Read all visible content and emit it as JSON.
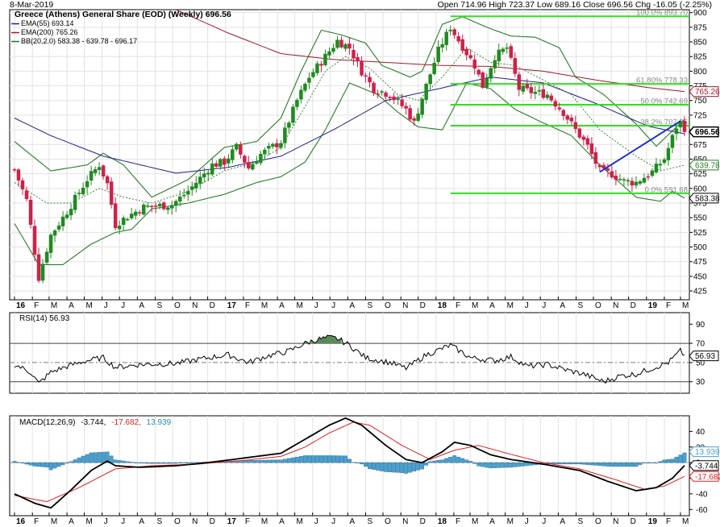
{
  "header": {
    "date": "8-Mar-2019",
    "title": "Greece (Athens) General Share (EOD) (Weekly) 696.56",
    "ohlc": "Open 714.96  High 723.37  Low 689.16  Close 696.56  Chg -16.05 (-2.25%)"
  },
  "legend": {
    "ema55": "EMA(55) 693.14",
    "ema200": "EMA(200) 765.26",
    "bb": "BB(20,2.0) 583.38 - 639.78 - 696.17",
    "rsi": "RSI(14) 56.93",
    "macd_name": "MACD(12,26,9)",
    "macd_v1": "-3.744,",
    "macd_v2": "-17.682,",
    "macd_v3": "13.939"
  },
  "colors": {
    "up": "#208a20",
    "down": "#d0204a",
    "ema55": "#20208a",
    "ema200": "#a01830",
    "bb": "#2a7a2a",
    "fib": "#33dd22",
    "trend": "#1a2ad0",
    "macd": "#000000",
    "signal": "#dd2222",
    "hist": "#4aa0d0",
    "rsiFill": "#5a8a5a"
  },
  "x_axis": {
    "labels": [
      "16",
      "F",
      "M",
      "A",
      "M",
      "J",
      "J",
      "A",
      "S",
      "O",
      "N",
      "D",
      "17",
      "F",
      "M",
      "A",
      "M",
      "J",
      "J",
      "A",
      "S",
      "O",
      "N",
      "D",
      "18",
      "F",
      "M",
      "A",
      "M",
      "J",
      "J",
      "A",
      "S",
      "O",
      "N",
      "D",
      "19",
      "F",
      "M"
    ],
    "bold": [
      "16",
      "17",
      "18",
      "19"
    ]
  },
  "chart_data": [
    {
      "type": "candlestick",
      "title": "Greece (Athens) General Share (EOD) (Weekly) 696.56",
      "x_start": "2016-01-01",
      "x_end": "2019-03-08",
      "ylim": [
        410,
        905
      ],
      "yticks": [
        425,
        450,
        475,
        500,
        525,
        550,
        575,
        600,
        625,
        650,
        675,
        700,
        725,
        750,
        775,
        800,
        825,
        850,
        875,
        900
      ],
      "price_anchors": [
        [
          "2016-01-01",
          632
        ],
        [
          "2016-01-22",
          580
        ],
        [
          "2016-02-12",
          448
        ],
        [
          "2016-03-04",
          520
        ],
        [
          "2016-04-01",
          560
        ],
        [
          "2016-05-06",
          615
        ],
        [
          "2016-05-27",
          640
        ],
        [
          "2016-06-10",
          608
        ],
        [
          "2016-06-24",
          538
        ],
        [
          "2016-07-15",
          552
        ],
        [
          "2016-08-12",
          568
        ],
        [
          "2016-09-30",
          572
        ],
        [
          "2016-10-28",
          595
        ],
        [
          "2016-12-09",
          640
        ],
        [
          "2016-12-30",
          645
        ],
        [
          "2017-01-20",
          670
        ],
        [
          "2017-02-10",
          635
        ],
        [
          "2017-03-03",
          658
        ],
        [
          "2017-04-07",
          680
        ],
        [
          "2017-05-05",
          750
        ],
        [
          "2017-05-26",
          790
        ],
        [
          "2017-06-23",
          825
        ],
        [
          "2017-07-14",
          852
        ],
        [
          "2017-08-04",
          840
        ],
        [
          "2017-08-25",
          800
        ],
        [
          "2017-09-15",
          770
        ],
        [
          "2017-10-13",
          760
        ],
        [
          "2017-11-10",
          735
        ],
        [
          "2017-11-24",
          712
        ],
        [
          "2017-12-15",
          775
        ],
        [
          "2018-01-05",
          835
        ],
        [
          "2018-01-26",
          875
        ],
        [
          "2018-02-16",
          842
        ],
        [
          "2018-03-09",
          810
        ],
        [
          "2018-03-23",
          775
        ],
        [
          "2018-04-13",
          825
        ],
        [
          "2018-05-04",
          840
        ],
        [
          "2018-05-25",
          770
        ],
        [
          "2018-06-15",
          765
        ],
        [
          "2018-07-13",
          760
        ],
        [
          "2018-08-10",
          730
        ],
        [
          "2018-08-31",
          700
        ],
        [
          "2018-09-21",
          672
        ],
        [
          "2018-10-12",
          630
        ],
        [
          "2018-11-02",
          625
        ],
        [
          "2018-11-23",
          612
        ],
        [
          "2018-12-14",
          610
        ],
        [
          "2019-01-11",
          628
        ],
        [
          "2019-02-01",
          650
        ],
        [
          "2019-02-22",
          705
        ],
        [
          "2019-03-01",
          712
        ],
        [
          "2019-03-08",
          696.56
        ]
      ],
      "last_candle": {
        "date": "2019-03-08",
        "open": 714.96,
        "high": 723.37,
        "low": 689.16,
        "close": 696.56
      },
      "ema55_anchors": [
        [
          "2016-01-01",
          720
        ],
        [
          "2016-03-04",
          690
        ],
        [
          "2016-06-03",
          655
        ],
        [
          "2016-10-07",
          626
        ],
        [
          "2017-01-06",
          636
        ],
        [
          "2017-04-07",
          655
        ],
        [
          "2017-07-07",
          700
        ],
        [
          "2017-10-06",
          750
        ],
        [
          "2018-01-05",
          770
        ],
        [
          "2018-04-06",
          790
        ],
        [
          "2018-07-06",
          780
        ],
        [
          "2018-10-05",
          745
        ],
        [
          "2019-01-04",
          706
        ],
        [
          "2019-03-08",
          693.14
        ]
      ],
      "ema200_anchors": [
        [
          "2016-10-07",
          905
        ],
        [
          "2017-01-06",
          865
        ],
        [
          "2017-04-07",
          830
        ],
        [
          "2017-07-07",
          820
        ],
        [
          "2017-10-06",
          815
        ],
        [
          "2018-01-05",
          810
        ],
        [
          "2018-04-06",
          808
        ],
        [
          "2018-07-06",
          800
        ],
        [
          "2018-10-05",
          785
        ],
        [
          "2019-01-04",
          772
        ],
        [
          "2019-03-08",
          765.26
        ]
      ],
      "bb_upper_anchors": [
        [
          "2016-01-01",
          680
        ],
        [
          "2016-03-04",
          630
        ],
        [
          "2016-05-06",
          640
        ],
        [
          "2016-06-03",
          660
        ],
        [
          "2016-07-08",
          640
        ],
        [
          "2016-08-26",
          585
        ],
        [
          "2016-10-28",
          615
        ],
        [
          "2016-12-30",
          670
        ],
        [
          "2017-02-24",
          680
        ],
        [
          "2017-04-07",
          720
        ],
        [
          "2017-05-12",
          800
        ],
        [
          "2017-06-16",
          870
        ],
        [
          "2017-07-21",
          862
        ],
        [
          "2017-09-01",
          848
        ],
        [
          "2017-09-29",
          810
        ],
        [
          "2017-11-17",
          790
        ],
        [
          "2017-12-08",
          800
        ],
        [
          "2018-01-12",
          880
        ],
        [
          "2018-02-16",
          893
        ],
        [
          "2018-03-30",
          875
        ],
        [
          "2018-05-11",
          860
        ],
        [
          "2018-06-22",
          858
        ],
        [
          "2018-08-03",
          840
        ],
        [
          "2018-08-31",
          790
        ],
        [
          "2018-10-19",
          760
        ],
        [
          "2018-12-14",
          710
        ],
        [
          "2019-01-18",
          672
        ],
        [
          "2019-02-22",
          705
        ],
        [
          "2019-03-08",
          718
        ]
      ],
      "bb_mid_anchors": [
        [
          "2016-01-01",
          610
        ],
        [
          "2016-02-26",
          575
        ],
        [
          "2016-04-08",
          575
        ],
        [
          "2016-05-27",
          600
        ],
        [
          "2016-07-08",
          585
        ],
        [
          "2016-08-26",
          575
        ],
        [
          "2016-10-28",
          595
        ],
        [
          "2016-12-30",
          630
        ],
        [
          "2017-02-24",
          645
        ],
        [
          "2017-04-07",
          670
        ],
        [
          "2017-05-19",
          740
        ],
        [
          "2017-06-23",
          800
        ],
        [
          "2017-07-28",
          825
        ],
        [
          "2017-09-08",
          805
        ],
        [
          "2017-10-27",
          760
        ],
        [
          "2017-12-01",
          750
        ],
        [
          "2018-01-12",
          790
        ],
        [
          "2018-02-23",
          840
        ],
        [
          "2018-04-06",
          815
        ],
        [
          "2018-05-18",
          810
        ],
        [
          "2018-07-06",
          785
        ],
        [
          "2018-08-24",
          760
        ],
        [
          "2018-10-12",
          700
        ],
        [
          "2018-12-14",
          655
        ],
        [
          "2019-01-25",
          630
        ],
        [
          "2019-03-08",
          639.78
        ]
      ],
      "bb_lower_anchors": [
        [
          "2016-01-01",
          540
        ],
        [
          "2016-02-12",
          470
        ],
        [
          "2016-03-25",
          470
        ],
        [
          "2016-05-13",
          505
        ],
        [
          "2016-06-24",
          525
        ],
        [
          "2016-07-22",
          530
        ],
        [
          "2016-08-26",
          565
        ],
        [
          "2016-10-28",
          575
        ],
        [
          "2016-12-30",
          590
        ],
        [
          "2017-02-24",
          610
        ],
        [
          "2017-04-07",
          620
        ],
        [
          "2017-05-19",
          645
        ],
        [
          "2017-06-23",
          700
        ],
        [
          "2017-08-04",
          780
        ],
        [
          "2017-09-22",
          760
        ],
        [
          "2017-10-27",
          730
        ],
        [
          "2017-12-01",
          705
        ],
        [
          "2018-01-12",
          700
        ],
        [
          "2018-02-23",
          780
        ],
        [
          "2018-04-06",
          770
        ],
        [
          "2018-05-18",
          735
        ],
        [
          "2018-06-29",
          715
        ],
        [
          "2018-08-24",
          690
        ],
        [
          "2018-10-12",
          640
        ],
        [
          "2018-12-14",
          585
        ],
        [
          "2019-01-25",
          578
        ],
        [
          "2019-02-15",
          595
        ],
        [
          "2019-03-08",
          583.38
        ]
      ],
      "fib_levels": [
        {
          "label": "100.0% 893.70",
          "value": 893.7
        },
        {
          "label": "61.80% 778.33",
          "value": 778.33
        },
        {
          "label": "50.0% 742.69",
          "value": 742.69
        },
        {
          "label": "38.2% 707.06",
          "value": 707.06
        },
        {
          "label": "0.0% 591.68",
          "value": 591.68
        }
      ],
      "fib_start": "2018-01-26",
      "trendline": [
        [
          "2018-10-12",
          628
        ],
        [
          "2019-03-01",
          715
        ]
      ],
      "right_tags": [
        {
          "text": "765.26",
          "value": 765.26,
          "style": "ema200"
        },
        {
          "text": "696.56",
          "value": 696.56,
          "style": "price"
        },
        {
          "text": "639.78",
          "value": 639.78,
          "style": "bb"
        },
        {
          "text": "583.38",
          "value": 583.38,
          "style": "plain"
        }
      ]
    },
    {
      "type": "line",
      "title": "RSI(14) 56.93",
      "ylim": [
        18,
        102
      ],
      "yticks": [
        30,
        50,
        70,
        90
      ],
      "levels": [
        30,
        50,
        70
      ],
      "anchors": [
        [
          "2016-01-01",
          48
        ],
        [
          "2016-01-29",
          40
        ],
        [
          "2016-02-12",
          28
        ],
        [
          "2016-03-04",
          40
        ],
        [
          "2016-04-01",
          46
        ],
        [
          "2016-05-06",
          52
        ],
        [
          "2016-06-03",
          55
        ],
        [
          "2016-06-24",
          45
        ],
        [
          "2016-08-05",
          48
        ],
        [
          "2016-10-07",
          49
        ],
        [
          "2016-11-04",
          52
        ],
        [
          "2016-12-02",
          55
        ],
        [
          "2017-01-06",
          58
        ],
        [
          "2017-02-10",
          50
        ],
        [
          "2017-03-10",
          56
        ],
        [
          "2017-04-21",
          62
        ],
        [
          "2017-05-19",
          70
        ],
        [
          "2017-06-09",
          74
        ],
        [
          "2017-06-30",
          76
        ],
        [
          "2017-07-14",
          75
        ],
        [
          "2017-08-04",
          68
        ],
        [
          "2017-09-01",
          55
        ],
        [
          "2017-10-13",
          50
        ],
        [
          "2017-11-10",
          44
        ],
        [
          "2017-12-15",
          58
        ],
        [
          "2018-01-26",
          68
        ],
        [
          "2018-03-02",
          55
        ],
        [
          "2018-04-13",
          52
        ],
        [
          "2018-05-11",
          56
        ],
        [
          "2018-06-08",
          46
        ],
        [
          "2018-07-13",
          48
        ],
        [
          "2018-08-17",
          42
        ],
        [
          "2018-09-14",
          38
        ],
        [
          "2018-10-19",
          30
        ],
        [
          "2018-11-16",
          36
        ],
        [
          "2018-12-14",
          38
        ],
        [
          "2019-01-11",
          44
        ],
        [
          "2019-02-08",
          50
        ],
        [
          "2019-03-01",
          62
        ],
        [
          "2019-03-08",
          56.93
        ]
      ],
      "tag": "56.93"
    },
    {
      "type": "line",
      "title": "MACD(12,26,9)",
      "ylim": [
        -68,
        60
      ],
      "yticks": [
        -60,
        -40,
        -20,
        0,
        20,
        40
      ],
      "macd_anchors": [
        [
          "2016-01-01",
          -40
        ],
        [
          "2016-02-05",
          -52
        ],
        [
          "2016-03-04",
          -58
        ],
        [
          "2016-04-08",
          -35
        ],
        [
          "2016-05-13",
          -10
        ],
        [
          "2016-06-10",
          2
        ],
        [
          "2016-06-24",
          -4
        ],
        [
          "2016-08-05",
          -6
        ],
        [
          "2016-10-07",
          -4
        ],
        [
          "2016-11-18",
          -1
        ],
        [
          "2016-12-23",
          2
        ],
        [
          "2017-02-03",
          6
        ],
        [
          "2017-04-07",
          12
        ],
        [
          "2017-05-19",
          30
        ],
        [
          "2017-06-30",
          48
        ],
        [
          "2017-07-28",
          57
        ],
        [
          "2017-08-25",
          48
        ],
        [
          "2017-10-06",
          22
        ],
        [
          "2017-11-10",
          4
        ],
        [
          "2017-12-08",
          0
        ],
        [
          "2018-01-12",
          14
        ],
        [
          "2018-02-02",
          26
        ],
        [
          "2018-03-02",
          22
        ],
        [
          "2018-04-06",
          10
        ],
        [
          "2018-05-11",
          4
        ],
        [
          "2018-07-06",
          -2
        ],
        [
          "2018-09-07",
          -10
        ],
        [
          "2018-10-26",
          -24
        ],
        [
          "2018-12-14",
          -36
        ],
        [
          "2019-01-18",
          -32
        ],
        [
          "2019-02-15",
          -20
        ],
        [
          "2019-03-08",
          -3.744
        ]
      ],
      "signal_anchors": [
        [
          "2016-01-01",
          -42
        ],
        [
          "2016-02-26",
          -50
        ],
        [
          "2016-04-22",
          -32
        ],
        [
          "2016-06-24",
          -8
        ],
        [
          "2016-08-26",
          -4
        ],
        [
          "2016-11-11",
          -2
        ],
        [
          "2017-02-03",
          3
        ],
        [
          "2017-04-07",
          8
        ],
        [
          "2017-05-19",
          20
        ],
        [
          "2017-06-30",
          38
        ],
        [
          "2017-08-11",
          52
        ],
        [
          "2017-09-08",
          48
        ],
        [
          "2017-11-03",
          22
        ],
        [
          "2017-12-22",
          4
        ],
        [
          "2018-02-02",
          16
        ],
        [
          "2018-03-16",
          22
        ],
        [
          "2018-05-04",
          12
        ],
        [
          "2018-07-06",
          0
        ],
        [
          "2018-09-07",
          -8
        ],
        [
          "2018-11-09",
          -22
        ],
        [
          "2018-12-28",
          -34
        ],
        [
          "2019-02-01",
          -30
        ],
        [
          "2019-03-08",
          -17.682
        ]
      ],
      "tags": [
        {
          "text": "13.939",
          "value": 13.939,
          "style": "hist"
        },
        {
          "text": "-3.744",
          "value": -3.744,
          "style": "macd"
        },
        {
          "text": "-17.682",
          "value": -17.682,
          "style": "signal"
        }
      ]
    }
  ]
}
